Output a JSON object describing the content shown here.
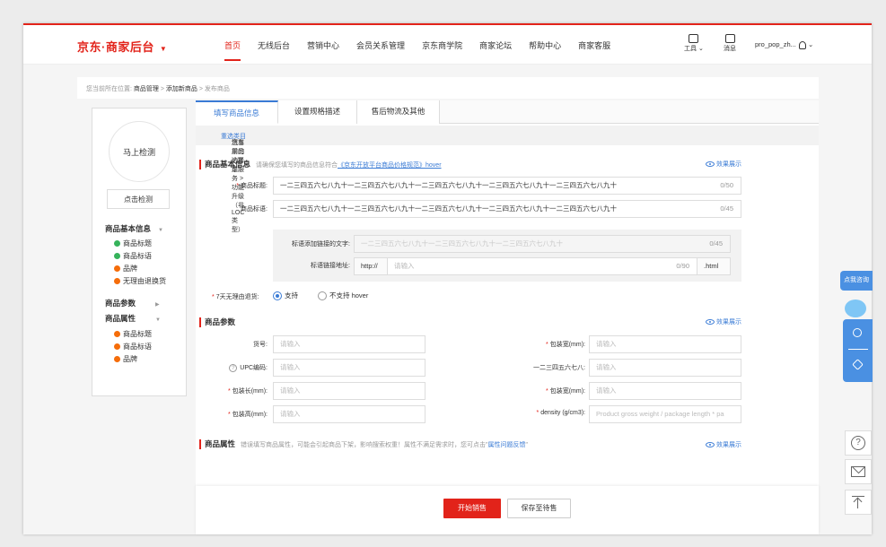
{
  "header": {
    "brand": "京东·商家后台",
    "nav": [
      "首页",
      "无线后台",
      "营销中心",
      "会员关系管理",
      "京东商学院",
      "商家论坛",
      "帮助中心",
      "商家客服"
    ],
    "tools_label": "工具",
    "message_label": "消息",
    "username": "pro_pop_zh..."
  },
  "breadcrumb": {
    "prefix": "您当前所在位置:",
    "items": [
      "商品管理",
      "添加新商品",
      "发布商品"
    ],
    "sep": " > "
  },
  "left_panel": {
    "detect_circle": "马上检测",
    "detect_button": "点击检测",
    "sections": [
      {
        "title": "商品基本信息",
        "items": [
          {
            "label": "商品标题",
            "status": "green"
          },
          {
            "label": "商品标语",
            "status": "green"
          },
          {
            "label": "品牌",
            "status": "orange"
          },
          {
            "label": "无理由退换货",
            "status": "orange"
          }
        ]
      },
      {
        "title": "商品参数",
        "items": []
      },
      {
        "title": "商品属性",
        "items": [
          {
            "label": "商品标题",
            "status": "orange"
          },
          {
            "label": "商品标语",
            "status": "orange"
          },
          {
            "label": "品牌",
            "status": "orange"
          }
        ]
      }
    ]
  },
  "tabs": [
    "填写商品信息",
    "设置规格描述",
    "售后物流及其他"
  ],
  "selection": {
    "prefix": "您当前的选择是:",
    "path": "汽车用品 > 汽车服务 > 功能升级（非LOC类型）",
    "reselect": "重选类目"
  },
  "basic_info": {
    "title": "商品基本信息",
    "hint_prefix": "请确保您填写的商品信息符合",
    "hint_link": "《京东开放平台商品价格规范》hover",
    "preview": "效果展示",
    "title_label": "商品标题:",
    "title_value": "一二三四五六七八九十一二三四五六七八九十一二三四五六七八九十一二三四五六七八九十一二三四五六七八九十",
    "title_count": "0/50",
    "slogan_label": "商品标语:",
    "slogan_value": "一二三四五六七八九十一二三四五六七八九十一二三四五六七八九十一二三四五六七八九十一二三四五六七八九十",
    "slogan_count": "0/45",
    "link_text_label": "标语添加链接的文字:",
    "link_text_placeholder": "一二三四五六七八九十一二三四五六七八九十一二三四五六七八九十",
    "link_text_count": "0/45",
    "link_url_label": "标语链接地址:",
    "link_url_prefix": "http://",
    "link_url_placeholder": "请输入",
    "link_url_count": "0/90",
    "link_url_suffix": ".html",
    "return_label": "7天无理由退货:",
    "return_yes": "支持",
    "return_no": "不支持 hover"
  },
  "params": {
    "title": "商品参数",
    "preview": "效果展示",
    "left_fields": [
      {
        "label": "货号:",
        "required": false,
        "help": false,
        "placeholder": "请输入"
      },
      {
        "label": "UPC编码:",
        "required": false,
        "help": true,
        "placeholder": "请输入"
      },
      {
        "label": "包装长(mm):",
        "required": true,
        "help": false,
        "placeholder": "请输入"
      },
      {
        "label": "包装高(mm):",
        "required": true,
        "help": false,
        "placeholder": "请输入"
      }
    ],
    "right_fields": [
      {
        "label": "包装宽(mm):",
        "required": true,
        "placeholder": "请输入"
      },
      {
        "label": "一二三四五六七八:",
        "required": false,
        "placeholder": "请输入"
      },
      {
        "label": "包装宽(mm):",
        "required": true,
        "placeholder": "请输入"
      },
      {
        "label": "density (g/cm3):",
        "required": true,
        "placeholder": "Product gross weight / package length * pa"
      }
    ]
  },
  "attributes": {
    "title": "商品属性",
    "hint_prefix": "错误填写商品属性，可能会引起商品下架，影响搜索权重！属性不满足需求时，您可点击\"",
    "hint_link": "属性问题反馈",
    "hint_suffix": "\"",
    "preview": "效果展示"
  },
  "actions": {
    "start_sale": "开始销售",
    "save_pending": "保存至待售"
  },
  "float": {
    "consult": "点我咨询"
  },
  "colors": {
    "brand_red": "#e2231a",
    "link_blue": "#3a7bd5",
    "ok_green": "#36b35b",
    "warn_orange": "#f56d0a"
  }
}
